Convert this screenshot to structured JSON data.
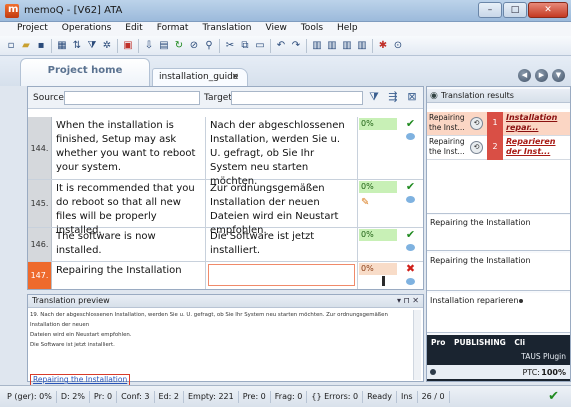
{
  "window": {
    "title": "memoQ - [V62] ATA",
    "minimize": "–",
    "maximize": "□",
    "close": "✕"
  },
  "menu": [
    "Project",
    "Operations",
    "Edit",
    "Format",
    "Translation",
    "View",
    "Tools",
    "Help"
  ],
  "toolbar_icons": [
    "new-icon",
    "open-icon",
    "save-icon",
    "sep",
    "table-icon",
    "sort-icon",
    "filter-icon",
    "settings-icon",
    "sep",
    "close-doc-icon",
    "sep",
    "confirm-icon",
    "lookup-icon",
    "copy-source-icon",
    "clear-icon",
    "find-icon",
    "sep",
    "cut-icon",
    "copy-icon",
    "paste-icon",
    "sep",
    "undo-icon",
    "redo-icon",
    "sep",
    "layout-1-icon",
    "layout-2-icon",
    "layout-3-icon",
    "layout-4-icon",
    "sep",
    "gear-icon",
    "help-icon"
  ],
  "tabs": {
    "home": "Project home",
    "document": "installation_guide",
    "document_close": "×"
  },
  "filter": {
    "source_label": "Source",
    "target_label": "Target"
  },
  "segments": [
    {
      "num": "144.",
      "source": "When the installation is finished, Setup may ask whether you want to reboot your system.",
      "target": "Nach der abgeschlossenen Installation, werden Sie u. U. gefragt, ob Sie Ihr System neu starten möchten.",
      "match": "0%",
      "status": "confirmed"
    },
    {
      "num": "145.",
      "source": "It is recommended that you do reboot so that all new files will be properly installed.",
      "target": "Zur ordnungsgemäßen Installation der neuen Dateien wird ein Neustart empfohlen.",
      "match": "0%",
      "status": "confirmed"
    },
    {
      "num": "146.",
      "source": "The software is now installed.",
      "target": "Die Software ist jetzt installiert.",
      "match": "0%",
      "status": "confirmed"
    },
    {
      "num": "147.",
      "source": "Repairing the Installation",
      "target": "",
      "match": "0%",
      "status": "error"
    }
  ],
  "preview": {
    "title": "Translation preview",
    "buttons": "▾ ⊓ ✕",
    "line1": "19.  Nach der abgeschlossenen Installation, werden Sie u. U. gefragt, ob Sie Ihr System neu starten möchten. Zur ordnungsgemäßen Installation der neuen",
    "line2": "Dateien wird ein Neustart empfohlen.",
    "line3": "Die Software ist jetzt installiert.",
    "link": "Repairing the Installation"
  },
  "results": {
    "title": "Translation results",
    "rows": [
      {
        "source": "Repairing the Inst...",
        "num": "1",
        "target": "Installation repar..."
      },
      {
        "source": "Repairing the Inst...",
        "num": "2",
        "target": "Reparieren der Inst..."
      }
    ],
    "box1": "Repairing the Installation",
    "box2": "Repairing the Installation",
    "box3": "Installation reparieren"
  },
  "taus": {
    "tabs": [
      "Pro",
      "PUBLISHING",
      "Cli"
    ],
    "plugin": "TAUS Plugin",
    "ptc": "PTC:",
    "pct": "100%"
  },
  "status": {
    "items": [
      "P (ger): 0%",
      "D: 2%",
      "Pr: 0",
      "Conf: 3",
      "Ed: 2",
      "Empty: 221",
      "Pre: 0",
      "Frag: 0",
      "{} Errors: 0",
      "Ready",
      "Ins",
      "26 / 0"
    ],
    "ok_icon": "✔"
  },
  "colors": {
    "active_row": "#ee6a2c",
    "match_green": "#c8f0b6",
    "match_warn": "#f8dcc8",
    "tm_number": "#d94f45"
  }
}
